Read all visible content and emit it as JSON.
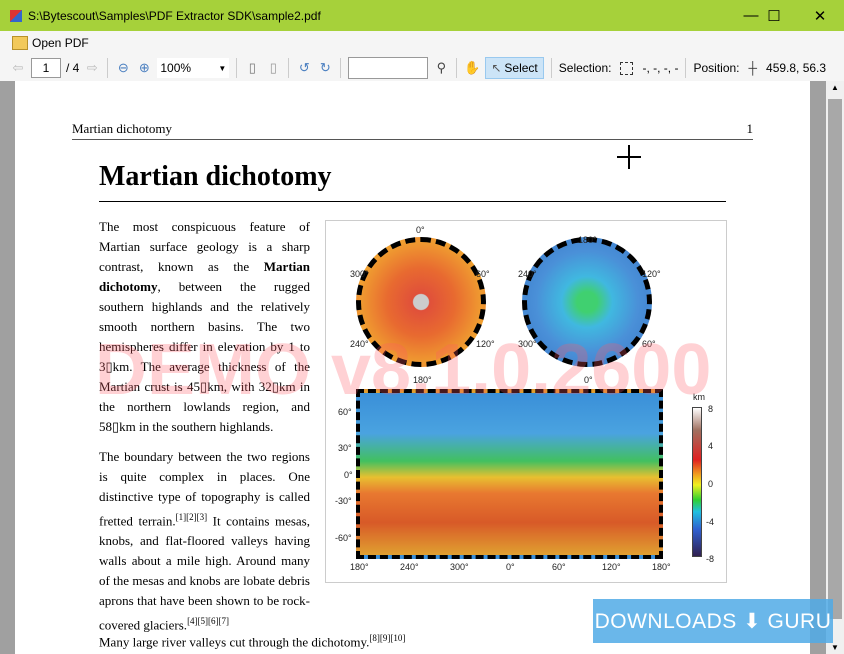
{
  "window": {
    "title": "S:\\Bytescout\\Samples\\PDF Extractor SDK\\sample2.pdf",
    "minimize": "—",
    "maximize": "☐",
    "close": "✕"
  },
  "menu": {
    "open_pdf": "Open PDF"
  },
  "toolbar": {
    "page_current": "1",
    "page_total": "/ 4",
    "zoom": "100%",
    "search_value": "",
    "select_label": "Select",
    "selection_label": "Selection:",
    "selection_value": "-, -, -, -",
    "position_label": "Position:",
    "position_value": "459.8, 56.3"
  },
  "document": {
    "running_head": "Martian dichotomy",
    "page_number": "1",
    "heading": "Martian dichotomy",
    "p1_a": "The most conspicuous feature of Martian surface geology is a sharp contrast, known as the ",
    "p1_bold": "Martian dichotomy",
    "p1_b": ", between the rugged southern highlands and the relatively smooth northern basins. The two hemispheres differ in elevation by 1 to 3▯km. The average thickness of the Martian crust is 45▯km, with 32▯km in the northern lowlands region, and 58▯km in the southern highlands.",
    "p2_a": "The boundary between the two regions is quite complex in places. One distinctive type of topography is called fretted terrain.",
    "p2_ref1": "[1][2][3]",
    "p2_b": " It contains mesas, knobs, and flat-floored valleys having walls about a mile high. Around many of the mesas and knobs are lobate debris aprons that have been shown to be rock-covered glaciers.",
    "p2_ref2": "[4][5][6][7]",
    "p3": "Many large river valleys cut through the dichotomy.",
    "p3_ref": "[8][9][10]",
    "figure": {
      "north_labels": [
        "0°",
        "60°",
        "120°",
        "180°",
        "240°",
        "300°"
      ],
      "south_labels": [
        "180°",
        "120°",
        "60°",
        "0°",
        "300°",
        "240°"
      ],
      "lat_labels": [
        "60°",
        "30°",
        "0°",
        "-30°",
        "-60°"
      ],
      "lon_labels": [
        "180°",
        "240°",
        "300°",
        "0°",
        "60°",
        "120°",
        "180°"
      ],
      "scale_unit": "km",
      "scale_labels": [
        "8",
        "4",
        "0",
        "-4",
        "-8"
      ]
    },
    "watermark": "DEMO v8.1.0.2600"
  },
  "overlay": {
    "logo": "DOWNLOADS ⬇ GURU"
  }
}
